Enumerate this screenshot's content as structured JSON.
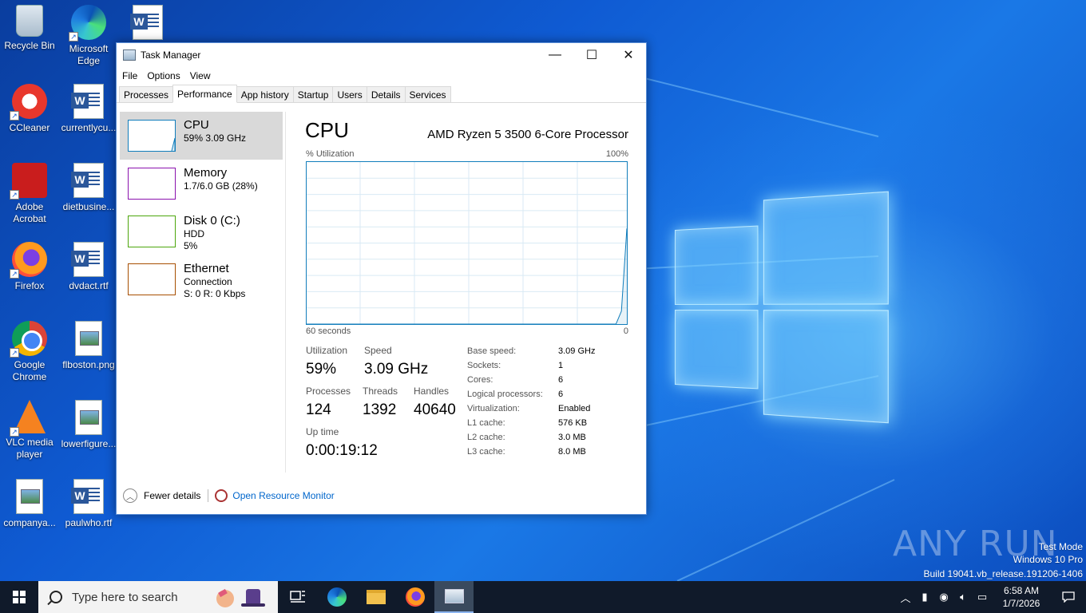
{
  "desktop": {
    "icons_col1": [
      {
        "label": "Recycle Bin",
        "kind": "recycle"
      },
      {
        "label": "CCleaner",
        "kind": "ccleaner"
      },
      {
        "label": "Adobe Acrobat",
        "kind": "acrobat"
      },
      {
        "label": "Firefox",
        "kind": "firefox"
      },
      {
        "label": "Google Chrome",
        "kind": "chrome"
      },
      {
        "label": "VLC media player",
        "kind": "vlc"
      },
      {
        "label": "companya...",
        "kind": "image"
      }
    ],
    "icons_col2": [
      {
        "label": "Microsoft Edge",
        "kind": "edge"
      },
      {
        "label": "currentlycu...",
        "kind": "word"
      },
      {
        "label": "dietbusine...",
        "kind": "word"
      },
      {
        "label": "dvdact.rtf",
        "kind": "word"
      },
      {
        "label": "flboston.png",
        "kind": "image"
      },
      {
        "label": "lowerfigure...",
        "kind": "image"
      },
      {
        "label": "paulwho.rtf",
        "kind": "word"
      }
    ],
    "icon_col3_top": {
      "kind": "word"
    }
  },
  "task_manager": {
    "title": "Task Manager",
    "controls": {
      "minimize": "—",
      "maximize": "☐",
      "close": "✕"
    },
    "menu": [
      "File",
      "Options",
      "View"
    ],
    "tabs": [
      "Processes",
      "Performance",
      "App history",
      "Startup",
      "Users",
      "Details",
      "Services"
    ],
    "active_tab": "Performance",
    "resources": [
      {
        "name": "CPU",
        "line1": "59%  3.09 GHz",
        "line2": "",
        "color": "#117dbb",
        "selected": true
      },
      {
        "name": "Memory",
        "line1": "1.7/6.0 GB (28%)",
        "line2": "",
        "color": "#8b12ae",
        "selected": false
      },
      {
        "name": "Disk 0 (C:)",
        "line1": "HDD",
        "line2": "5%",
        "color": "#4da60c",
        "selected": false
      },
      {
        "name": "Ethernet",
        "line1": "Connection",
        "line2": "S: 0  R: 0 Kbps",
        "color": "#a74f01",
        "selected": false
      }
    ],
    "cpu": {
      "heading": "CPU",
      "model": "AMD Ryzen 5 3500 6-Core Processor",
      "util_label": "% Utilization",
      "util_max": "100%",
      "axis_left": "60 seconds",
      "axis_right": "0",
      "graph_color": "#117dbb",
      "graph_points_pct": [
        0,
        0,
        0,
        0,
        0,
        0,
        0,
        0,
        0,
        0,
        0,
        0,
        0,
        0,
        0,
        0,
        0,
        0,
        0,
        0,
        0,
        0,
        0,
        0,
        0,
        0,
        0,
        0,
        0,
        0,
        0,
        0,
        0,
        0,
        0,
        0,
        0,
        0,
        0,
        0,
        0,
        0,
        0,
        0,
        0,
        0,
        0,
        0,
        0,
        0,
        0,
        0,
        0,
        0,
        0,
        0,
        0,
        0,
        8,
        59
      ],
      "stats": {
        "utilization_label": "Utilization",
        "utilization": "59%",
        "speed_label": "Speed",
        "speed": "3.09 GHz",
        "processes_label": "Processes",
        "processes": "124",
        "threads_label": "Threads",
        "threads": "1392",
        "handles_label": "Handles",
        "handles": "40640",
        "uptime_label": "Up time",
        "uptime": "0:00:19:12"
      },
      "specs": [
        {
          "label": "Base speed:",
          "value": "3.09 GHz"
        },
        {
          "label": "Sockets:",
          "value": "1"
        },
        {
          "label": "Cores:",
          "value": "6"
        },
        {
          "label": "Logical processors:",
          "value": "6"
        },
        {
          "label": "Virtualization:",
          "value": "Enabled"
        },
        {
          "label": "L1 cache:",
          "value": "576 KB"
        },
        {
          "label": "L2 cache:",
          "value": "3.0 MB"
        },
        {
          "label": "L3 cache:",
          "value": "8.0 MB"
        }
      ]
    },
    "footer": {
      "fewer_details": "Fewer details",
      "resource_monitor": "Open Resource Monitor"
    }
  },
  "watermark": {
    "logo": "ANY RUN",
    "line1": "Test Mode",
    "line2": "Windows 10 Pro",
    "line3": "Build 19041.vb_release.191206-1406"
  },
  "taskbar": {
    "search_placeholder": "Type here to search",
    "pinned": [
      "task-view-icon",
      "edge-icon",
      "file-explorer-icon",
      "firefox-icon",
      "task-manager-icon"
    ],
    "clock_time": "6:58 AM",
    "clock_date": "1/7/2026"
  }
}
